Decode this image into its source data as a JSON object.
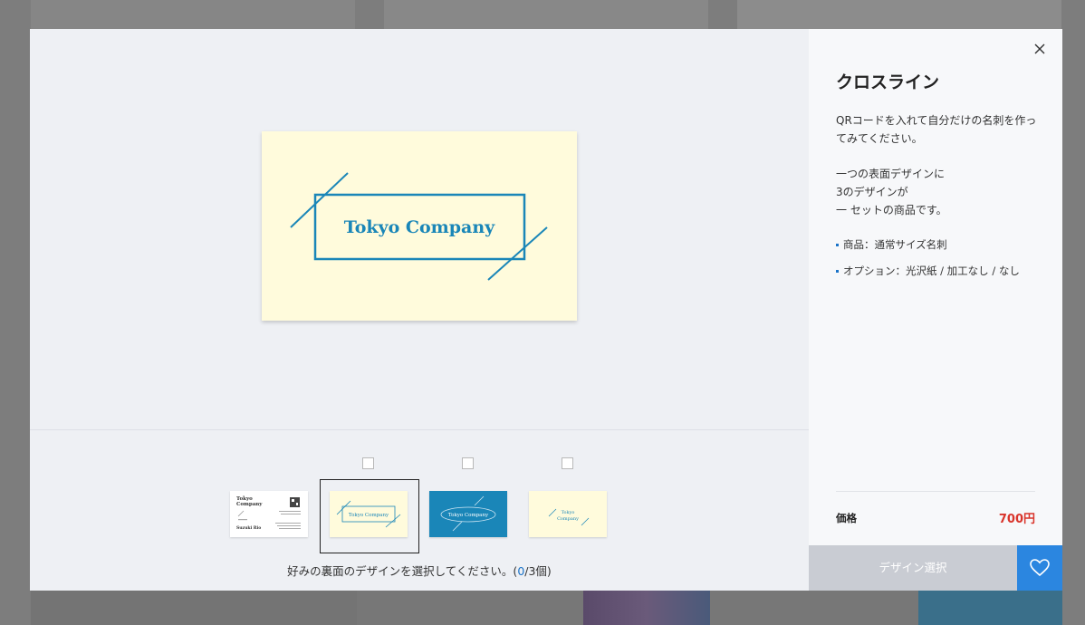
{
  "preview": {
    "company_name": "Tokyo Company"
  },
  "thumbnails": [
    {
      "name": "front",
      "company_line1": "Tokyo",
      "company_line2": "Company",
      "person": "Suzuki Rio",
      "has_checkbox": false
    },
    {
      "name": "back-option-1",
      "company_name": "Tokyo Company",
      "has_checkbox": true,
      "checked": false,
      "selected": true
    },
    {
      "name": "back-option-2",
      "company_name": "Tokyo Company",
      "has_checkbox": true,
      "checked": false,
      "selected": false
    },
    {
      "name": "back-option-3",
      "company_line1": "Tokyo",
      "company_line2": "Company",
      "has_checkbox": true,
      "checked": false,
      "selected": false
    }
  ],
  "hint": {
    "prefix": "好みの裏面のデザインを選択してください。(",
    "selected_count": "0",
    "suffix": "/3個)"
  },
  "info": {
    "title": "クロスライン",
    "description": [
      "QRコードを入れて自分だけの名刺を作ってみてください。",
      "",
      "一つの表面デザインに",
      "3のデザインが",
      "一 セットの商品です。"
    ],
    "specs": [
      "商品：通常サイズ名刺",
      "オプション：光沢紙 / 加工なし / なし"
    ],
    "price_label": "価格",
    "price_value": "700円",
    "select_button": "デザイン選択"
  },
  "colors": {
    "accent": "#1a73c8",
    "card_teal": "#1a86b8",
    "card_cream": "#fffbdc",
    "price_red": "#d9342b",
    "favorite_blue": "#2b86e0"
  },
  "icons": {
    "close": "close-icon",
    "favorite": "heart-icon"
  }
}
